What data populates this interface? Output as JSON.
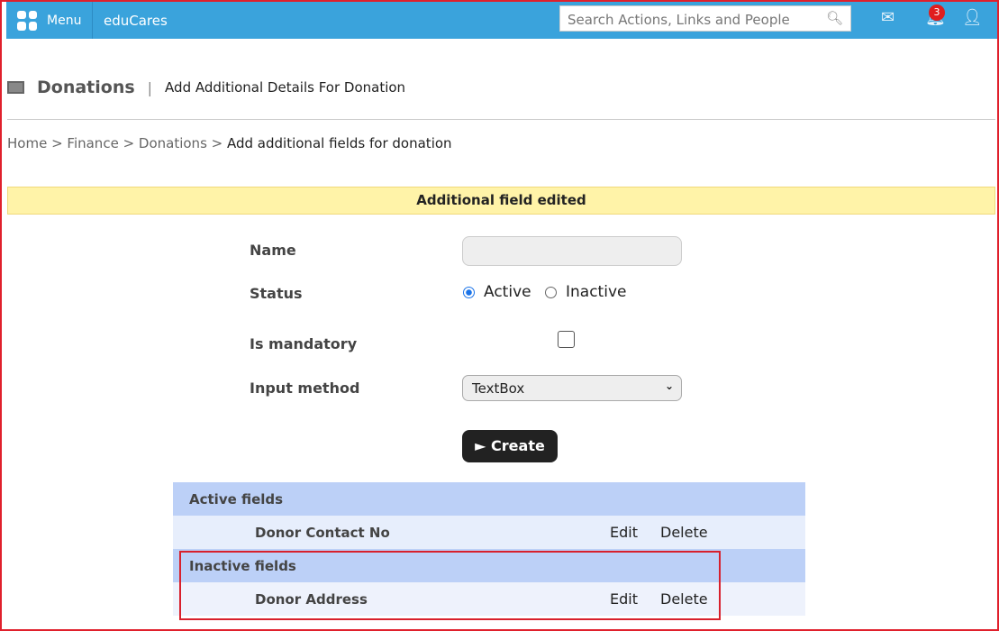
{
  "topbar": {
    "menu_label": "Menu",
    "brand": "eduCares",
    "search_placeholder": "Search Actions, Links and People",
    "notification_count": "3"
  },
  "header": {
    "title": "Donations",
    "subtitle": "Add Additional Details For Donation"
  },
  "breadcrumb": [
    "Home",
    "Finance",
    "Donations",
    "Add additional fields for donation"
  ],
  "message": "Additional field edited",
  "form": {
    "name_label": "Name",
    "name_value": "",
    "status_label": "Status",
    "status_options": [
      "Active",
      "Inactive"
    ],
    "status_selected": "Active",
    "mandatory_label": "Is mandatory",
    "mandatory_checked": false,
    "input_method_label": "Input method",
    "input_method_value": "TextBox",
    "create_label": "► Create"
  },
  "fields": {
    "active_header": "Active fields",
    "active": [
      {
        "name": "Donor Contact No",
        "edit": "Edit",
        "delete": "Delete"
      }
    ],
    "inactive_header": "Inactive fields",
    "inactive": [
      {
        "name": "Donor Address",
        "edit": "Edit",
        "delete": "Delete"
      }
    ]
  }
}
